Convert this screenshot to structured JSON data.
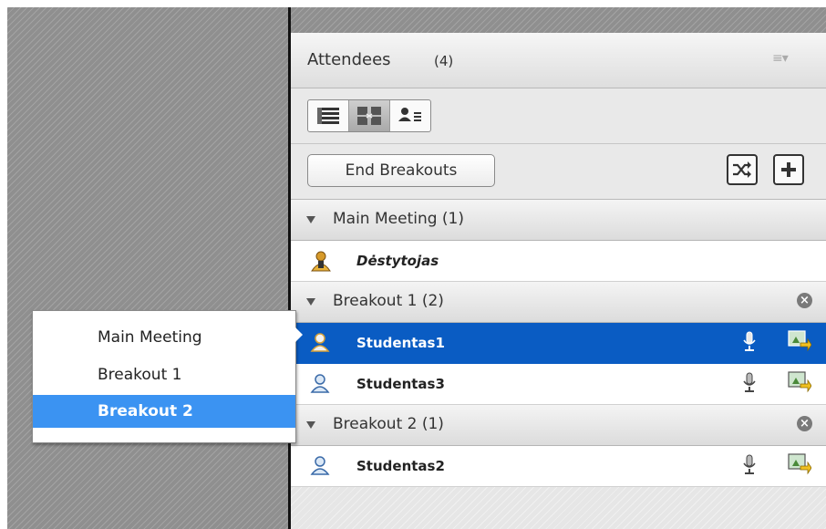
{
  "attendees": {
    "title": "Attendees",
    "count": "(4)",
    "menu_icon": "list-menu-icon",
    "view_modes": [
      "list-view-icon",
      "breakout-view-icon",
      "attendee-detail-view-icon"
    ],
    "active_view": "breakout-view-icon",
    "end_breakouts_label": "End Breakouts",
    "shuffle_icon": "shuffle-icon",
    "add_icon": "plus-icon",
    "groups": [
      {
        "label": "Main Meeting (1)",
        "closable": false,
        "members": [
          {
            "name": "Dėstytojas",
            "role": "host",
            "selected": false
          }
        ]
      },
      {
        "label": "Breakout 1 (2)",
        "closable": true,
        "members": [
          {
            "name": "Studentas1",
            "role": "participant",
            "selected": true
          },
          {
            "name": "Studentas3",
            "role": "participant",
            "selected": false
          }
        ]
      },
      {
        "label": "Breakout 2 (1)",
        "closable": true,
        "members": [
          {
            "name": "Studentas2",
            "role": "participant",
            "selected": false
          }
        ]
      }
    ]
  },
  "move_menu": {
    "items": [
      "Main Meeting",
      "Breakout 1",
      "Breakout 2"
    ],
    "highlighted": "Breakout 2"
  },
  "colors": {
    "selection": "#0a5cc3",
    "menu_highlight": "#3b93f2",
    "header_bg": "#e9e9e9"
  }
}
